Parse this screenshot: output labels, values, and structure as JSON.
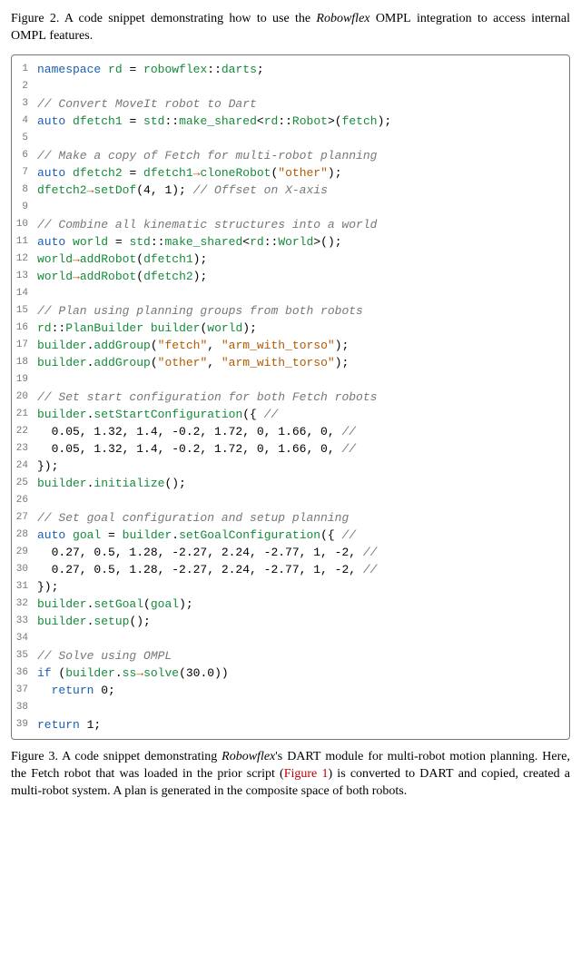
{
  "caption_top": {
    "label": "Figure 2.",
    "text_before_ompl": " A code snippet demonstrating how to use the ",
    "robowflex": "Robowflex",
    "ompl1": " OMPL",
    "mid": " integration to access internal ",
    "ompl2": "OMPL",
    "after": " features."
  },
  "code": {
    "lines": [
      {
        "n": 1,
        "html": "<span class='kw'>namespace</span> <span class='idg'>rd</span> = <span class='idg'>robowflex</span>::<span class='idg'>darts</span>;"
      },
      {
        "n": 2,
        "html": ""
      },
      {
        "n": 3,
        "html": "<span class='cm'>// Convert MoveIt robot to Dart</span>"
      },
      {
        "n": 4,
        "html": "<span class='kw'>auto</span> <span class='idg'>dfetch1</span> = <span class='idg'>std</span>::<span class='idg'>make_shared</span>&lt;<span class='idg'>rd</span>::<span class='idg'>Robot</span>&gt;(<span class='idg'>fetch</span>);"
      },
      {
        "n": 5,
        "html": ""
      },
      {
        "n": 6,
        "html": "<span class='cm'>// Make a copy of Fetch for multi-robot planning</span>"
      },
      {
        "n": 7,
        "html": "<span class='kw'>auto</span> <span class='idg'>dfetch2</span> = <span class='idg'>dfetch1</span><span class='arrow'>→</span><span class='idg'>cloneRobot</span>(<span class='st'>\"other\"</span>);"
      },
      {
        "n": 8,
        "html": "<span class='idg'>dfetch2</span><span class='arrow'>→</span><span class='idg'>setDof</span>(4, 1); <span class='cm'>// Offset on X-axis</span>"
      },
      {
        "n": 9,
        "html": ""
      },
      {
        "n": 10,
        "html": "<span class='cm'>// Combine all kinematic structures into a world</span>"
      },
      {
        "n": 11,
        "html": "<span class='kw'>auto</span> <span class='idg'>world</span> = <span class='idg'>std</span>::<span class='idg'>make_shared</span>&lt;<span class='idg'>rd</span>::<span class='idg'>World</span>&gt;();"
      },
      {
        "n": 12,
        "html": "<span class='idg'>world</span><span class='arrow'>→</span><span class='idg'>addRobot</span>(<span class='idg'>dfetch1</span>);"
      },
      {
        "n": 13,
        "html": "<span class='idg'>world</span><span class='arrow'>→</span><span class='idg'>addRobot</span>(<span class='idg'>dfetch2</span>);"
      },
      {
        "n": 14,
        "html": ""
      },
      {
        "n": 15,
        "html": "<span class='cm'>// Plan using planning groups from both robots</span>"
      },
      {
        "n": 16,
        "html": "<span class='idg'>rd</span>::<span class='idg'>PlanBuilder</span> <span class='idg'>builder</span>(<span class='idg'>world</span>);"
      },
      {
        "n": 17,
        "html": "<span class='idg'>builder</span>.<span class='idg'>addGroup</span>(<span class='st'>\"fetch\"</span>, <span class='st'>\"arm_with_torso\"</span>);"
      },
      {
        "n": 18,
        "html": "<span class='idg'>builder</span>.<span class='idg'>addGroup</span>(<span class='st'>\"other\"</span>, <span class='st'>\"arm_with_torso\"</span>);"
      },
      {
        "n": 19,
        "html": ""
      },
      {
        "n": 20,
        "html": "<span class='cm'>// Set start configuration for both Fetch robots</span>"
      },
      {
        "n": 21,
        "html": "<span class='idg'>builder</span>.<span class='idg'>setStartConfiguration</span>({ <span class='cm'>//</span>"
      },
      {
        "n": 22,
        "html": "  0.05, 1.32, 1.4, -0.2, 1.72, 0, 1.66, 0, <span class='cm'>//</span>"
      },
      {
        "n": 23,
        "html": "  0.05, 1.32, 1.4, -0.2, 1.72, 0, 1.66, 0, <span class='cm'>//</span>"
      },
      {
        "n": 24,
        "html": "});"
      },
      {
        "n": 25,
        "html": "<span class='idg'>builder</span>.<span class='idg'>initialize</span>();"
      },
      {
        "n": 26,
        "html": ""
      },
      {
        "n": 27,
        "html": "<span class='cm'>// Set goal configuration and setup planning</span>"
      },
      {
        "n": 28,
        "html": "<span class='kw'>auto</span> <span class='idg'>goal</span> = <span class='idg'>builder</span>.<span class='idg'>setGoalConfiguration</span>({ <span class='cm'>//</span>"
      },
      {
        "n": 29,
        "html": "  0.27, 0.5, 1.28, -2.27, 2.24, -2.77, 1, -2, <span class='cm'>//</span>"
      },
      {
        "n": 30,
        "html": "  0.27, 0.5, 1.28, -2.27, 2.24, -2.77, 1, -2, <span class='cm'>//</span>"
      },
      {
        "n": 31,
        "html": "});"
      },
      {
        "n": 32,
        "html": "<span class='idg'>builder</span>.<span class='idg'>setGoal</span>(<span class='idg'>goal</span>);"
      },
      {
        "n": 33,
        "html": "<span class='idg'>builder</span>.<span class='idg'>setup</span>();"
      },
      {
        "n": 34,
        "html": ""
      },
      {
        "n": 35,
        "html": "<span class='cm'>// Solve using OMPL</span>"
      },
      {
        "n": 36,
        "html": "<span class='kw'>if</span> (<span class='idg'>builder</span>.<span class='idg'>ss</span><span class='arrow'>→</span><span class='idg'>solve</span>(30.0))"
      },
      {
        "n": 37,
        "html": "  <span class='kw'>return</span> 0;"
      },
      {
        "n": 38,
        "html": ""
      },
      {
        "n": 39,
        "html": "<span class='kw'>return</span> 1;"
      }
    ]
  },
  "caption_bottom": {
    "label": "Figure 3.",
    "t1": " A code snippet demonstrating ",
    "robowflex": "Robowflex",
    "t2": "'s ",
    "dart1": "DART",
    "t3": " module for multi-robot motion planning. Here, the Fetch robot that was loaded in the prior script (",
    "link": "Figure 1",
    "t4": ") is converted to ",
    "dart2": "DART",
    "t5": " and copied, created a multi-robot system. A plan is generated in the composite space of both robots."
  }
}
